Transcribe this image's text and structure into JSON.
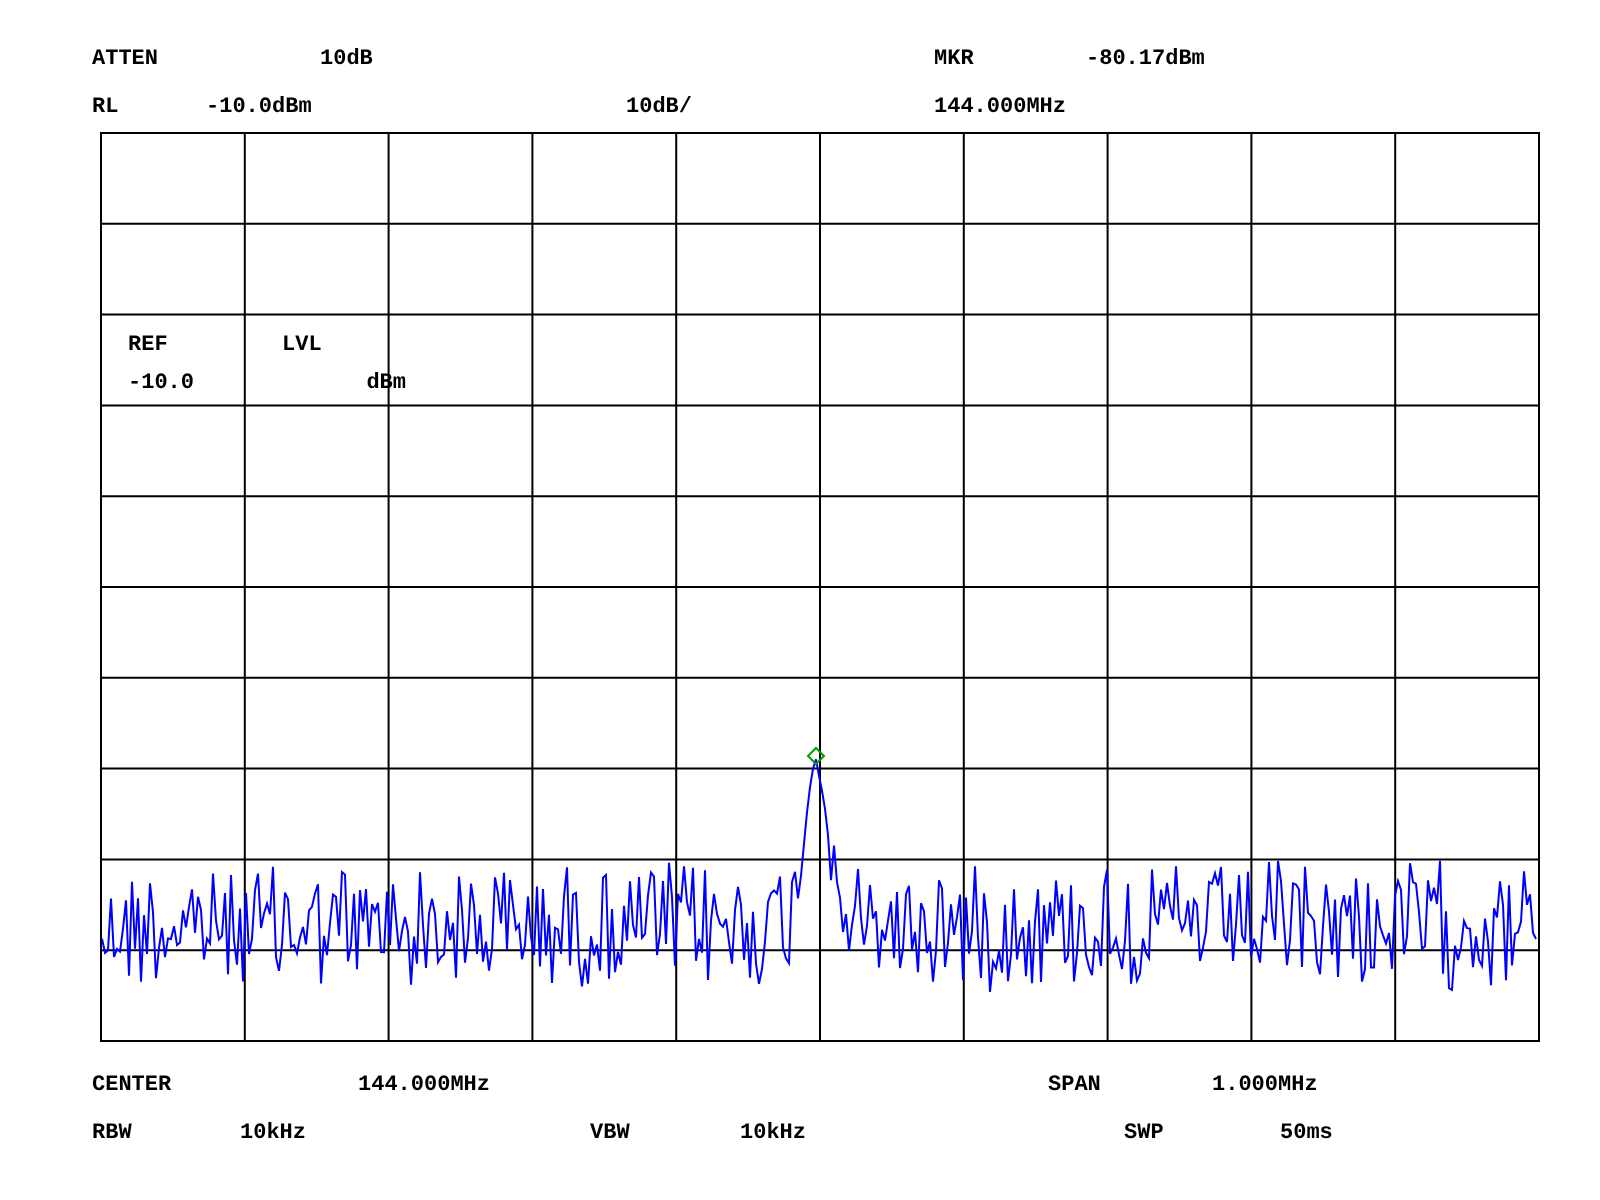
{
  "header": [
    [
      "ATTEN",
      "10dB",
      "MKR",
      "-80.17dBm"
    ],
    [
      "RL",
      "-10.0dBm",
      "10dB/",
      "144.000MHz"
    ]
  ],
  "ref_level": {
    "labels": [
      "REF",
      "LVL"
    ],
    "value": "-10.0",
    "unit": "dBm"
  },
  "footer": [
    [
      "CENTER",
      "144.000MHz",
      "SPAN",
      "1.000MHz"
    ],
    [
      "RBW",
      "10kHz",
      "VBW",
      "10kHz",
      "SWP",
      "50ms"
    ]
  ]
}
